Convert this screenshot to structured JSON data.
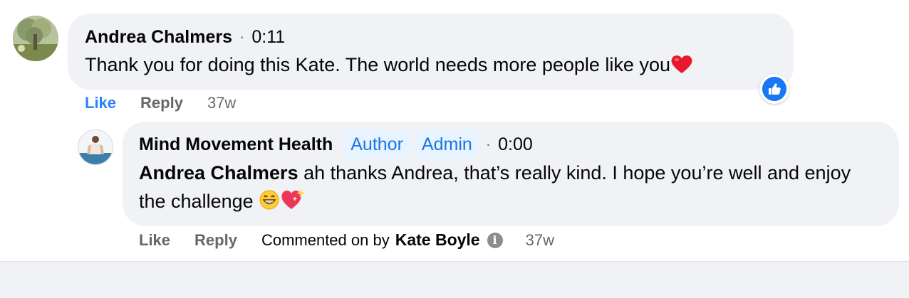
{
  "comment": {
    "author": "Andrea Chalmers",
    "separator": "·",
    "time": "0:11",
    "text": "Thank you for doing this Kate. The world needs more people like you",
    "actions": {
      "like": "Like",
      "reply": "Reply",
      "age": "37w"
    },
    "reaction_icon": "like-reaction-icon"
  },
  "reply": {
    "author": "Mind Movement Health",
    "badges": [
      "Author",
      "Admin"
    ],
    "separator": "·",
    "time": "0:00",
    "mention": "Andrea Chalmers",
    "text": " ah thanks Andrea, that’s really kind. I hope you’re well and enjoy the challenge ",
    "actions": {
      "like": "Like",
      "reply": "Reply",
      "commented_on_by": "Commented on by",
      "commenter": "Kate Boyle",
      "info": "i",
      "age": "37w"
    }
  },
  "colors": {
    "accent": "#1877f2",
    "bubble": "#f0f2f5",
    "muted": "#65676b",
    "like_active": "#2d7ff9"
  }
}
